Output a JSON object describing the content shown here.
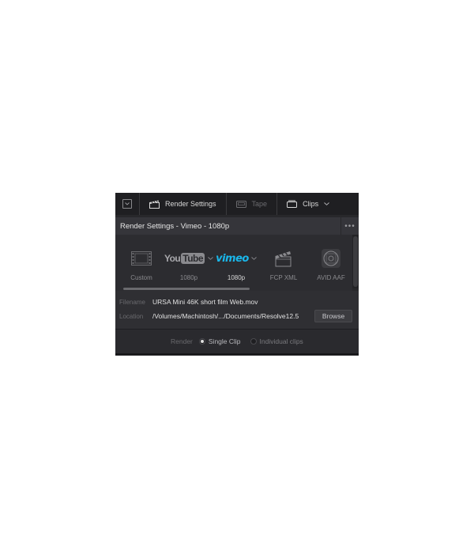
{
  "toolbar": {
    "render_settings_label": "Render Settings",
    "tape_label": "Tape",
    "clips_label": "Clips"
  },
  "header": {
    "title": "Render Settings - Vimeo - 1080p",
    "more": "•••"
  },
  "presets": [
    {
      "name": "custom",
      "label": "Custom",
      "icon": "film-strip-icon",
      "active": false
    },
    {
      "name": "youtube",
      "label": "1080p",
      "icon": "youtube-logo-icon",
      "logo_text_a": "You",
      "logo_text_b": "Tube",
      "active": false
    },
    {
      "name": "vimeo",
      "label": "1080p",
      "icon": "vimeo-logo-icon",
      "logo_text": "vimeo",
      "active": true
    },
    {
      "name": "fcp-xml",
      "label": "FCP XML",
      "icon": "clapperboard-icon",
      "active": false
    },
    {
      "name": "avid-aaf",
      "label": "AVID AAF",
      "icon": "avid-reel-icon",
      "active": false
    }
  ],
  "file": {
    "filename_label": "Filename",
    "filename_value": "URSA Mini 46K short film Web.mov",
    "location_label": "Location",
    "location_value": "/Volumes/Machintosh/.../Documents/Resolve12.5",
    "browse_label": "Browse"
  },
  "render": {
    "label": "Render",
    "single_clip": "Single Clip",
    "individual_clips": "Individual clips"
  },
  "colors": {
    "vimeo_blue": "#1ab7ea",
    "panel_bg": "#28282b"
  }
}
